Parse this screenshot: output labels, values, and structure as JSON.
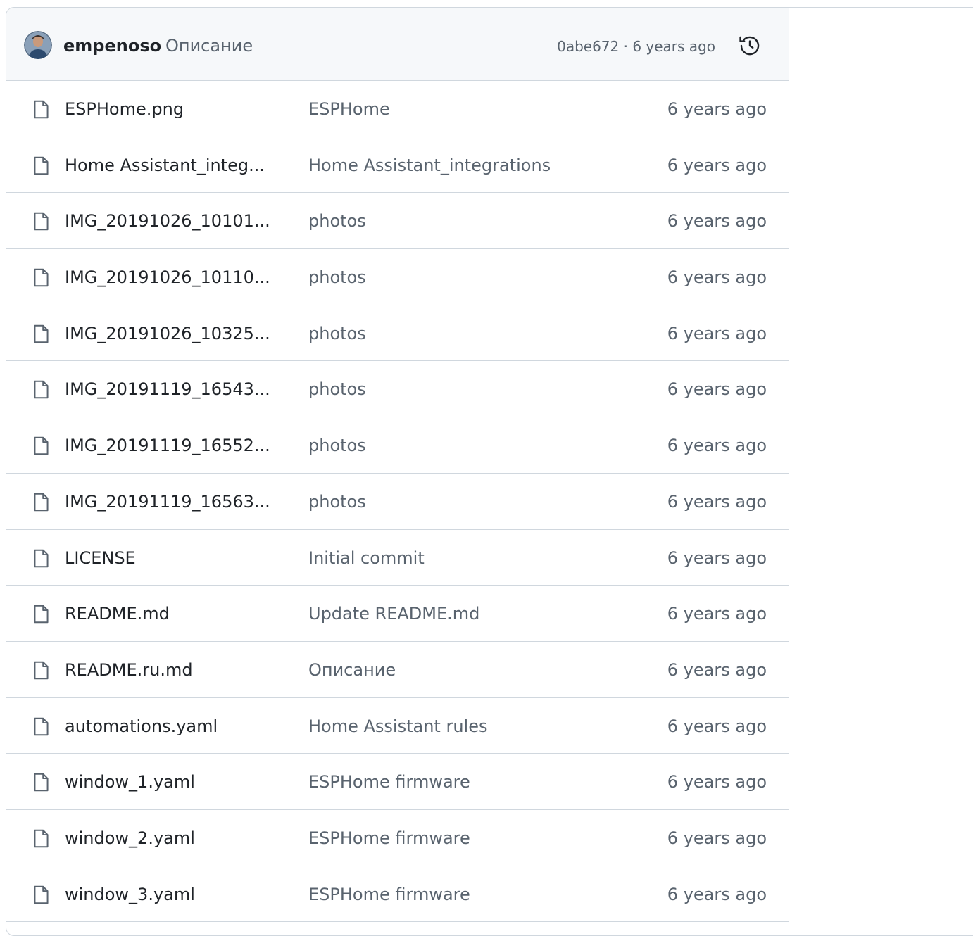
{
  "commit": {
    "author": "empenoso",
    "message": "Описание",
    "hash": "0abe672",
    "separator": " · ",
    "age": "6 years ago",
    "avatar_icon": "user-avatar",
    "history_icon": "history-icon"
  },
  "files": [
    {
      "name": "ESPHome.png",
      "message": "ESPHome",
      "age": "6 years ago"
    },
    {
      "name": "Home Assistant_integ...",
      "message": "Home Assistant_integrations",
      "age": "6 years ago"
    },
    {
      "name": "IMG_20191026_10101...",
      "message": "photos",
      "age": "6 years ago"
    },
    {
      "name": "IMG_20191026_10110...",
      "message": "photos",
      "age": "6 years ago"
    },
    {
      "name": "IMG_20191026_10325...",
      "message": "photos",
      "age": "6 years ago"
    },
    {
      "name": "IMG_20191119_16543...",
      "message": "photos",
      "age": "6 years ago"
    },
    {
      "name": "IMG_20191119_16552...",
      "message": "photos",
      "age": "6 years ago"
    },
    {
      "name": "IMG_20191119_16563...",
      "message": "photos",
      "age": "6 years ago"
    },
    {
      "name": "LICENSE",
      "message": "Initial commit",
      "age": "6 years ago"
    },
    {
      "name": "README.md",
      "message": "Update README.md",
      "age": "6 years ago"
    },
    {
      "name": "README.ru.md",
      "message": "Описание",
      "age": "6 years ago"
    },
    {
      "name": "automations.yaml",
      "message": "Home Assistant rules",
      "age": "6 years ago"
    },
    {
      "name": "window_1.yaml",
      "message": "ESPHome firmware",
      "age": "6 years ago"
    },
    {
      "name": "window_2.yaml",
      "message": "ESPHome firmware",
      "age": "6 years ago"
    },
    {
      "name": "window_3.yaml",
      "message": "ESPHome firmware",
      "age": "6 years ago"
    }
  ],
  "colors": {
    "border": "#d0d7de",
    "header_bg": "#f6f8fa",
    "muted_text": "#59636e",
    "text": "#1f2328"
  }
}
